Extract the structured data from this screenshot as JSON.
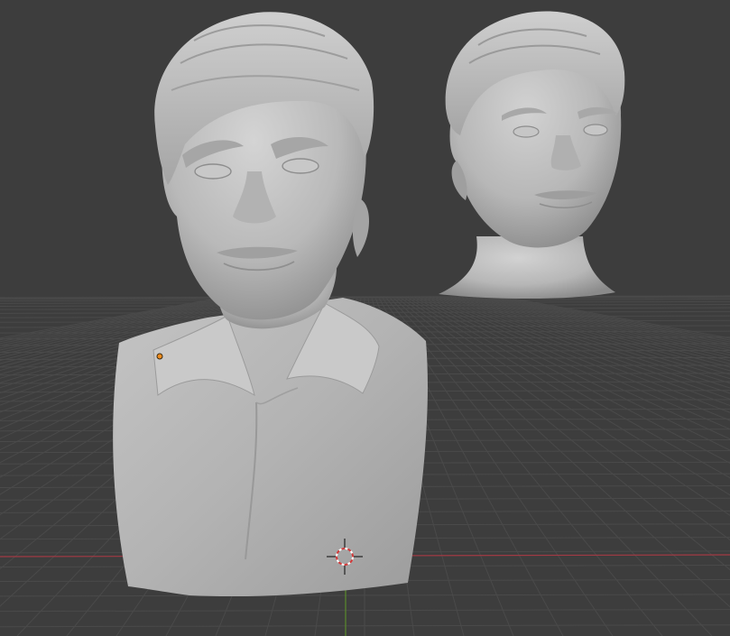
{
  "viewport": {
    "background": "#3d3d3d",
    "grid_color": "#4a4a4a",
    "x_axis_color": "#a23a44",
    "y_axis_color": "#5b8a2c"
  },
  "scene": {
    "objects": [
      {
        "name": "bust-large",
        "type": "sculpt-mesh",
        "material_color": "#bdbdbd"
      },
      {
        "name": "head-small",
        "type": "sculpt-mesh",
        "material_color": "#bdbdbd"
      }
    ],
    "origin_dot_color": "#f08c1e",
    "cursor_icon": "3d-cursor-icon"
  }
}
